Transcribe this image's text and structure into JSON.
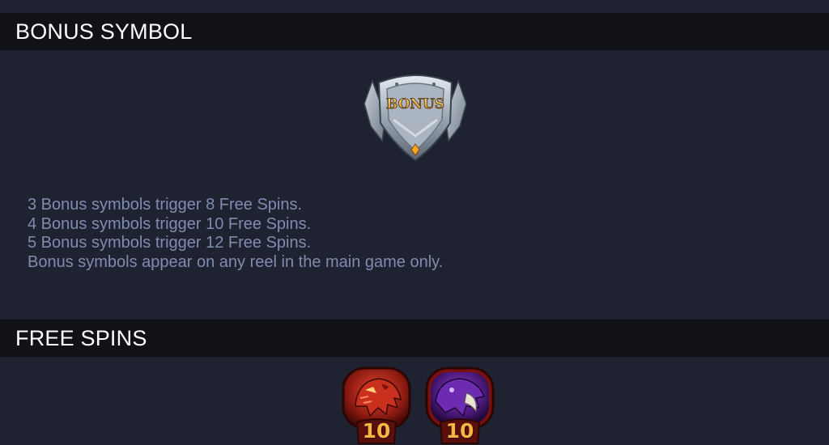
{
  "sections": {
    "bonus": {
      "title": "BONUS SYMBOL",
      "symbol": {
        "icon": "bonus-shield-icon",
        "label": "BONUS"
      },
      "rules": [
        "3 Bonus symbols trigger 8 Free Spins.",
        "4 Bonus symbols trigger 10 Free Spins.",
        "5 Bonus symbols trigger 12 Free Spins.",
        "Bonus symbols appear on any reel in the main game only."
      ]
    },
    "free_spins": {
      "title": "FREE SPINS",
      "symbols": [
        {
          "icon": "red-dragon-icon",
          "value": "10"
        },
        {
          "icon": "purple-dragon-icon",
          "value": "10"
        }
      ]
    }
  },
  "colors": {
    "background": "#1f2331",
    "header_bg": "#111217",
    "rule_text": "#7f8cb0",
    "gold": "#f5b544"
  }
}
